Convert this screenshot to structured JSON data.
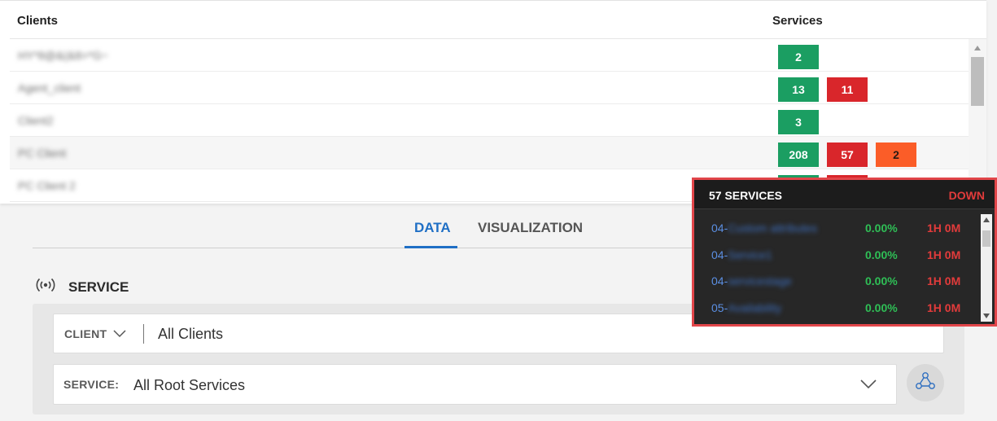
{
  "clients_table": {
    "header_clients": "Clients",
    "header_services": "Services",
    "rows": [
      {
        "name": "HY*8@&(&8>*G~",
        "badges": [
          {
            "value": "2",
            "color": "green"
          }
        ]
      },
      {
        "name": "Agent_client",
        "badges": [
          {
            "value": "13",
            "color": "green"
          },
          {
            "value": "11",
            "color": "red"
          }
        ]
      },
      {
        "name": "Client2",
        "badges": [
          {
            "value": "3",
            "color": "green"
          }
        ]
      },
      {
        "name": "PC Client",
        "badges": [
          {
            "value": "208",
            "color": "green"
          },
          {
            "value": "57",
            "color": "red"
          },
          {
            "value": "2",
            "color": "orange"
          }
        ]
      },
      {
        "name": "PC Client 2",
        "badges": [
          {
            "value": "",
            "color": "green"
          },
          {
            "value": "",
            "color": "red"
          }
        ]
      }
    ]
  },
  "tabs": {
    "data_label": "DATA",
    "visualization_label": "VISUALIZATION"
  },
  "service_section": {
    "title": "SERVICE",
    "client_label": "CLIENT",
    "client_value": "All Clients",
    "service_label": "SERVICE:",
    "service_value": "All Root Services"
  },
  "popup": {
    "title": "57 SERVICES",
    "status": "DOWN",
    "items": [
      {
        "prefix": "04-",
        "hidden": "Custom attributes",
        "pct": "0.00%",
        "duration": "1H 0M"
      },
      {
        "prefix": "04-",
        "hidden": "Service1",
        "pct": "0.00%",
        "duration": "1H 0M"
      },
      {
        "prefix": "04-",
        "hidden": "servicestage",
        "pct": "0.00%",
        "duration": "1H 0M"
      },
      {
        "prefix": "05-",
        "hidden": "Availability",
        "pct": "0.00%",
        "duration": "1H 0M"
      }
    ]
  },
  "colors": {
    "green": "#1b9e62",
    "red": "#d9262b",
    "orange": "#fb5d28",
    "accent_blue": "#1f6fc5",
    "popup_border": "#e2464a"
  },
  "icons": {
    "service": "broadcast-icon",
    "tree": "hierarchy-icon",
    "chevron": "chevron-down-icon"
  }
}
